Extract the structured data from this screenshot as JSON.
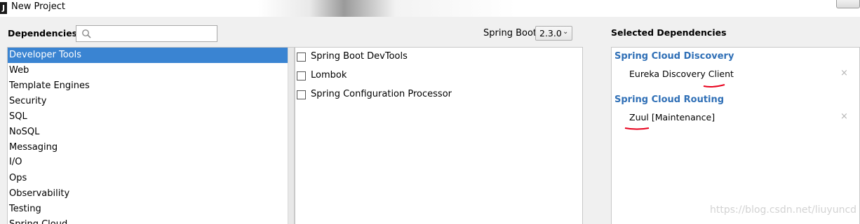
{
  "window": {
    "title": "New Project",
    "app_icon": "intellij-icon"
  },
  "dependencies": {
    "label": "Dependencies",
    "search_placeholder": "",
    "spring_boot_label": "Spring Boot",
    "spring_boot_version": "2.3.0"
  },
  "categories": [
    "Developer Tools",
    "Web",
    "Template Engines",
    "Security",
    "SQL",
    "NoSQL",
    "Messaging",
    "I/O",
    "Ops",
    "Observability",
    "Testing",
    "Spring Cloud"
  ],
  "selected_category": "Developer Tools",
  "options": [
    {
      "label": "Spring Boot DevTools",
      "checked": false
    },
    {
      "label": "Lombok",
      "checked": false
    },
    {
      "label": "Spring Configuration Processor",
      "checked": false
    }
  ],
  "selected": {
    "label": "Selected Dependencies",
    "groups": [
      {
        "name": "Spring Cloud Discovery",
        "items": [
          "Eureka Discovery Client"
        ]
      },
      {
        "name": "Spring Cloud Routing",
        "items": [
          "Zuul [Maintenance]"
        ]
      }
    ],
    "remove_glyph": "×"
  },
  "watermark": "https://blog.csdn.net/liuyuncd",
  "colors": {
    "selection": "#3a84d2",
    "group_heading": "#2f6fb6",
    "annotation": "#e8001c"
  }
}
